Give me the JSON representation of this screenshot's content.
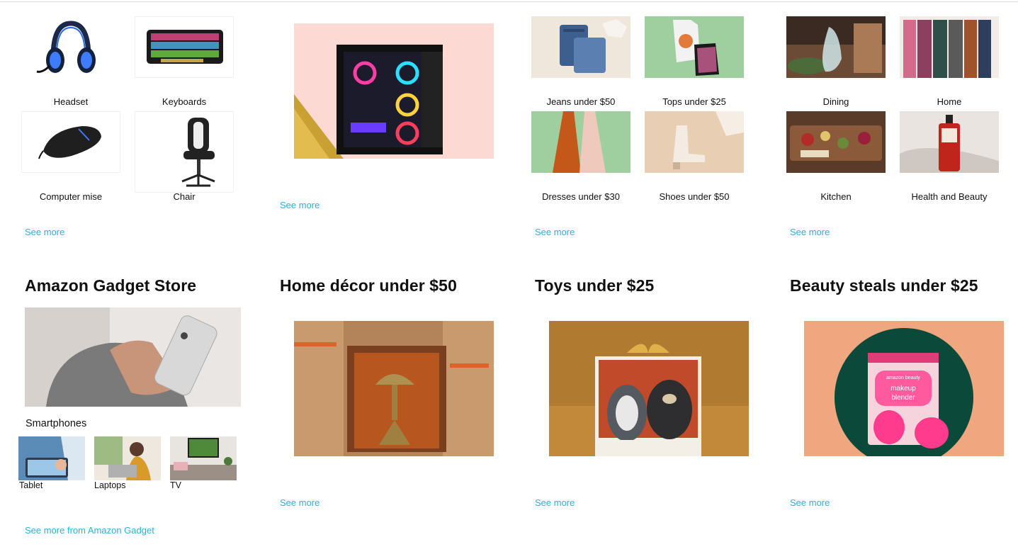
{
  "cards_top": [
    {
      "items": [
        {
          "label": "Headset"
        },
        {
          "label": "Keyboards"
        },
        {
          "label": "Computer mise"
        },
        {
          "label": "Chair"
        }
      ],
      "see_more": "See more"
    },
    {
      "see_more": "See more"
    },
    {
      "items": [
        {
          "label": "Jeans under $50"
        },
        {
          "label": "Tops under $25"
        },
        {
          "label": "Dresses under $30"
        },
        {
          "label": "Shoes under $50"
        }
      ],
      "see_more": "See more"
    },
    {
      "items": [
        {
          "label": "Dining"
        },
        {
          "label": "Home"
        },
        {
          "label": "Kitchen"
        },
        {
          "label": "Health and Beauty"
        }
      ],
      "see_more": "See more"
    }
  ],
  "cards_bottom": [
    {
      "title": "Amazon Gadget Store",
      "main_label": "Smartphones",
      "sub_items": [
        {
          "label": "Tablet"
        },
        {
          "label": "Laptops"
        },
        {
          "label": "TV"
        }
      ],
      "see_more": "See more from Amazon Gadget"
    },
    {
      "title": "Home décor under $50",
      "see_more": "See more"
    },
    {
      "title": "Toys under $25",
      "see_more": "See more"
    },
    {
      "title": "Beauty steals under $25",
      "see_more": "See more"
    }
  ],
  "image_text": {
    "makeup_brand": "amazon beauty",
    "makeup_line1": "makeup",
    "makeup_line2": "blender"
  },
  "colors": {
    "link": "#2bb1d6",
    "text": "#111111"
  }
}
